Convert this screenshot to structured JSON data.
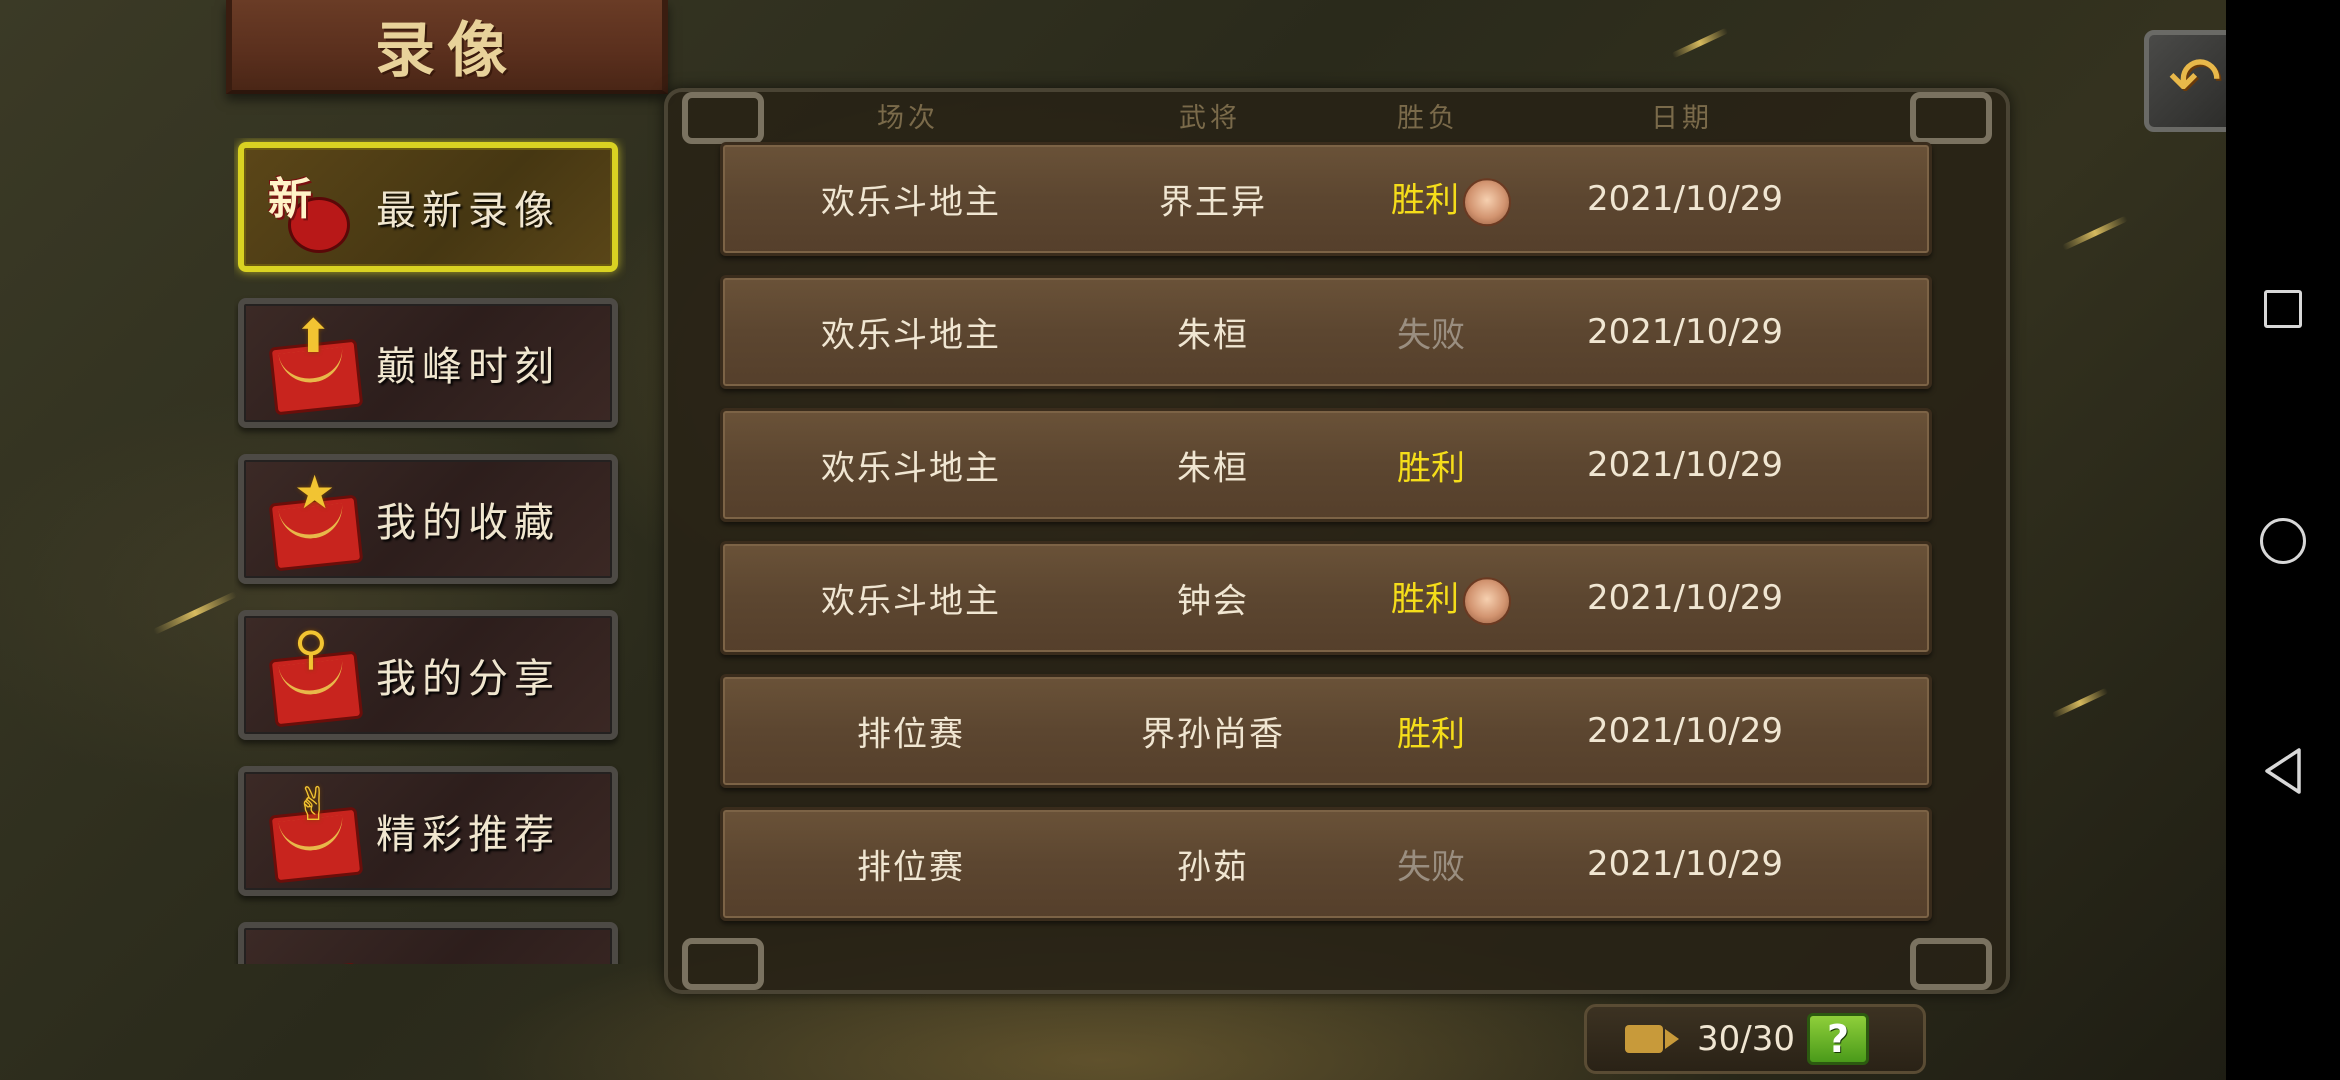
{
  "title": "录像",
  "sidebar": {
    "items": [
      {
        "label": "最新录像",
        "icon": "new-replay-icon",
        "badge": "新",
        "active": true
      },
      {
        "label": "巅峰时刻",
        "icon": "peak-moment-envelope-icon"
      },
      {
        "label": "我的收藏",
        "icon": "favorite-star-envelope-icon"
      },
      {
        "label": "我的分享",
        "icon": "share-envelope-icon"
      },
      {
        "label": "精彩推荐",
        "icon": "recommend-envelope-icon"
      }
    ]
  },
  "table": {
    "headers": [
      "场次",
      "武将",
      "胜负",
      "日期"
    ],
    "rows": [
      {
        "mode": "欢乐斗地主",
        "hero": "界王异",
        "result": "胜利",
        "win": true,
        "medal": true,
        "date": "2021/10/29"
      },
      {
        "mode": "欢乐斗地主",
        "hero": "朱桓",
        "result": "失败",
        "win": false,
        "medal": false,
        "date": "2021/10/29"
      },
      {
        "mode": "欢乐斗地主",
        "hero": "朱桓",
        "result": "胜利",
        "win": true,
        "medal": false,
        "date": "2021/10/29"
      },
      {
        "mode": "欢乐斗地主",
        "hero": "钟会",
        "result": "胜利",
        "win": true,
        "medal": true,
        "date": "2021/10/29"
      },
      {
        "mode": "排位赛",
        "hero": "界孙尚香",
        "result": "胜利",
        "win": true,
        "medal": false,
        "date": "2021/10/29"
      },
      {
        "mode": "排位赛",
        "hero": "孙茹",
        "result": "失败",
        "win": false,
        "medal": false,
        "date": "2021/10/29"
      }
    ]
  },
  "footer": {
    "count": "30/30",
    "help_label": "?"
  },
  "colors": {
    "win": "#f5dd1a",
    "lose": "#9a8e80",
    "active_border": "#d9d222"
  }
}
